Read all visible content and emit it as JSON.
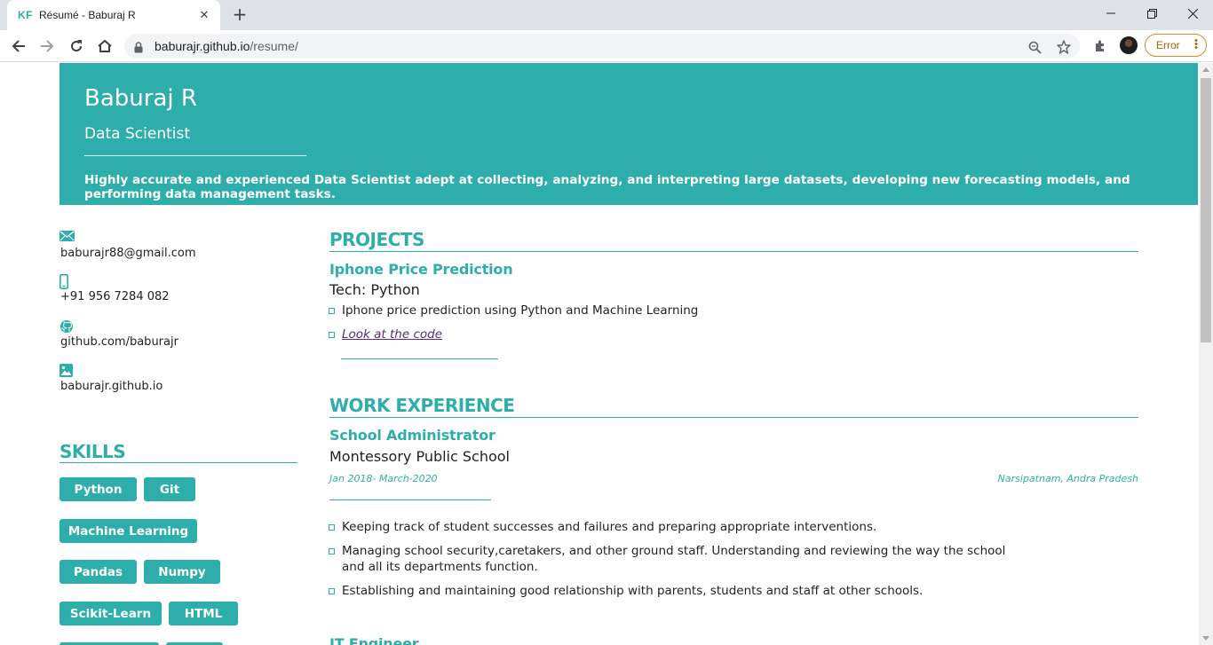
{
  "browser": {
    "tab_icon_text": "KF",
    "tab_title": "Résumé - Baburaj R",
    "url_host": "baburajr.github.io",
    "url_path": "/resume/",
    "error_label": "Error"
  },
  "profile": {
    "name": "Baburaj R",
    "role": "Data Scientist",
    "summary": "Highly accurate and experienced Data Scientist adept at collecting, analyzing, and interpreting large datasets, developing new forecasting models, and performing data management tasks."
  },
  "contact": {
    "email": "baburajr88@gmail.com",
    "phone": "+91 956 7284 082",
    "github": "github.com/baburajr",
    "website": "baburajr.github.io"
  },
  "skills": {
    "title": "SKILLS",
    "items": [
      "Python",
      "Git",
      "Machine Learning",
      "Pandas",
      "Numpy",
      "Scikit-Learn",
      "HTML"
    ]
  },
  "projects": {
    "title": "PROJECTS",
    "items": [
      {
        "name": "Iphone Price Prediction",
        "tech": "Tech: Python",
        "bullets": [
          "Iphone price prediction using Python and Machine Learning"
        ],
        "link_text": "Look at the code"
      }
    ]
  },
  "work": {
    "title": "WORK EXPERIENCE",
    "items": [
      {
        "title": "School Administrator",
        "org": "Montessory Public School",
        "dates": "Jan 2018- March-2020",
        "location": "Narsipatnam, Andra Pradesh",
        "bullets": [
          "Keeping track of student successes and failures and preparing appropriate interventions.",
          "Managing school security,caretakers, and other ground staff. Understanding and reviewing the way the school and all its departments function.",
          "Establishing and maintaining good relationship with parents, students and staff at other schools."
        ]
      },
      {
        "title": "IT Engineer"
      }
    ]
  },
  "colors": {
    "accent": "#2eaeaa",
    "link": "#5b2a7a",
    "error": "#b06000"
  }
}
